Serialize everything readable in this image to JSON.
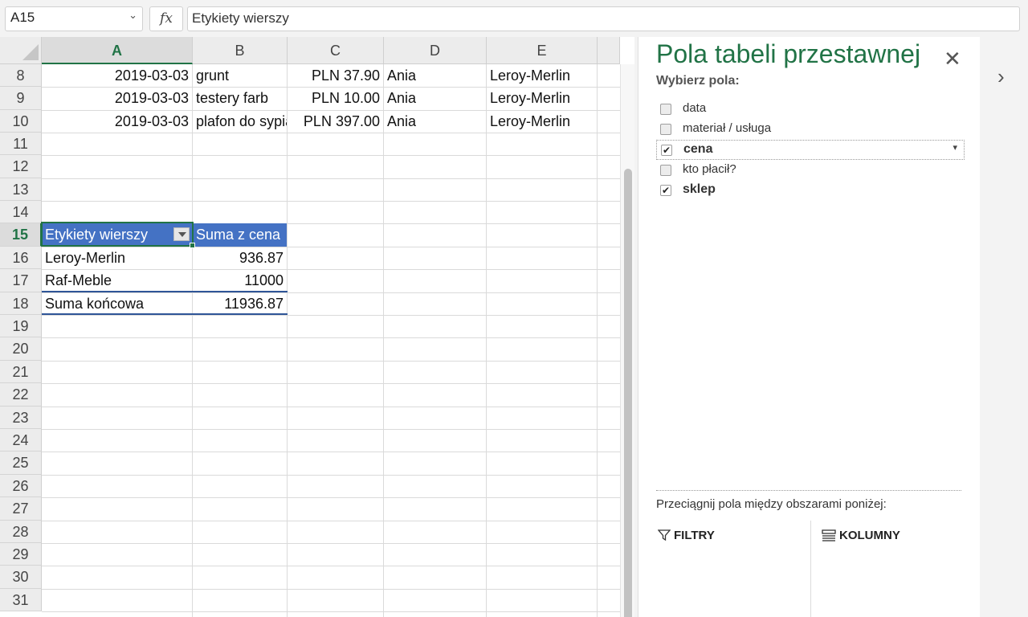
{
  "formula_bar": {
    "name_box": "A15",
    "fx": "fx",
    "formula": "Etykiety wierszy"
  },
  "columns": [
    "A",
    "B",
    "C",
    "D",
    "E"
  ],
  "selected_column": "A",
  "rows": [
    "8",
    "9",
    "10",
    "11",
    "12",
    "13",
    "14",
    "15",
    "16",
    "17",
    "18",
    "19",
    "20",
    "21",
    "22",
    "23",
    "24",
    "25",
    "26",
    "27",
    "28",
    "29",
    "30",
    "31"
  ],
  "selected_row": "15",
  "data_rows": [
    {
      "date": "2019-03-03",
      "item": "grunt",
      "price": "PLN 37.90",
      "who": "Ania",
      "shop": "Leroy-Merlin"
    },
    {
      "date": "2019-03-03",
      "item": "testery farb",
      "price": "PLN 10.00",
      "who": "Ania",
      "shop": "Leroy-Merlin"
    },
    {
      "date": "2019-03-03",
      "item": "plafon do sypialni",
      "price": "PLN 397.00",
      "who": "Ania",
      "shop": "Leroy-Merlin"
    }
  ],
  "pivot": {
    "header_label": "Etykiety wierszy",
    "header_value": "Suma z cena",
    "rows": [
      {
        "label": "Leroy-Merlin",
        "value": "936.87"
      },
      {
        "label": "Raf-Meble",
        "value": "11000"
      }
    ],
    "total_label": "Suma końcowa",
    "total_value": "11936.87"
  },
  "pane": {
    "title": "Pola tabeli przestawnej",
    "choose_label": "Wybierz pola:",
    "fields": [
      {
        "label": "data",
        "checked": false
      },
      {
        "label": "materiał / usługa",
        "checked": false
      },
      {
        "label": "cena",
        "checked": true
      },
      {
        "label": "kto płacił?",
        "checked": false
      },
      {
        "label": "sklep",
        "checked": true
      }
    ],
    "drag_hint": "Przeciągnij pola między obszarami poniżej:",
    "areas": {
      "filters": "FILTRY",
      "columns": "KOLUMNY"
    }
  },
  "icons": {
    "close": "close-icon",
    "expand": "chevron-right-icon",
    "filter": "filter-icon",
    "columns": "columns-icon"
  },
  "colors": {
    "accent": "#217346",
    "pivot_header": "#4472c4"
  }
}
